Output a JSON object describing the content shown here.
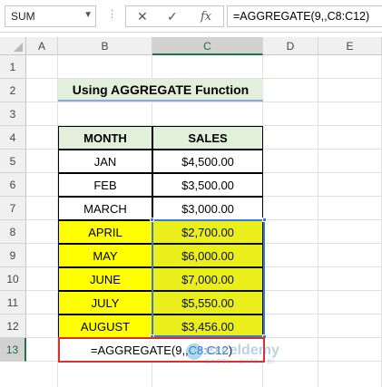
{
  "name_box": {
    "value": "SUM"
  },
  "formula_bar": {
    "separator": "⋮",
    "cancel_glyph": "✕",
    "enter_glyph": "✓",
    "fx_label": "fx",
    "formula": "=AGGREGATE(9,,C8:C12)"
  },
  "columns": [
    "A",
    "B",
    "C",
    "D",
    "E"
  ],
  "selected_column": "C",
  "rows": [
    "1",
    "2",
    "3",
    "4",
    "5",
    "6",
    "7",
    "8",
    "9",
    "10",
    "11",
    "12",
    "13"
  ],
  "selected_row": "13",
  "sheet": {
    "title": "Using AGGREGATE Function",
    "headers": {
      "month": "MONTH",
      "sales": "SALES"
    },
    "data": [
      {
        "month": "JAN",
        "sales": "$4,500.00",
        "highlight": false
      },
      {
        "month": "FEB",
        "sales": "$3,500.00",
        "highlight": false
      },
      {
        "month": "MARCH",
        "sales": "$3,000.00",
        "highlight": false
      },
      {
        "month": "APRIL",
        "sales": "$2,700.00",
        "highlight": true
      },
      {
        "month": "MAY",
        "sales": "$6,000.00",
        "highlight": true
      },
      {
        "month": "JUNE",
        "sales": "$7,000.00",
        "highlight": true
      },
      {
        "month": "JULY",
        "sales": "$5,550.00",
        "highlight": true
      },
      {
        "month": "AUGUST",
        "sales": "$3,456.00",
        "highlight": true
      }
    ],
    "active_cell": {
      "prefix": "=AGGREGATE(9,,",
      "ref": "C8:C12",
      "suffix": ")"
    }
  },
  "watermark": {
    "name": "exceldemy",
    "tagline": "EXCEL · DATA · BI"
  },
  "colors": {
    "highlight": "#ffff00",
    "header_fill": "#e2efda",
    "selection_border": "#3b78d8",
    "active_border": "#d9302c"
  }
}
